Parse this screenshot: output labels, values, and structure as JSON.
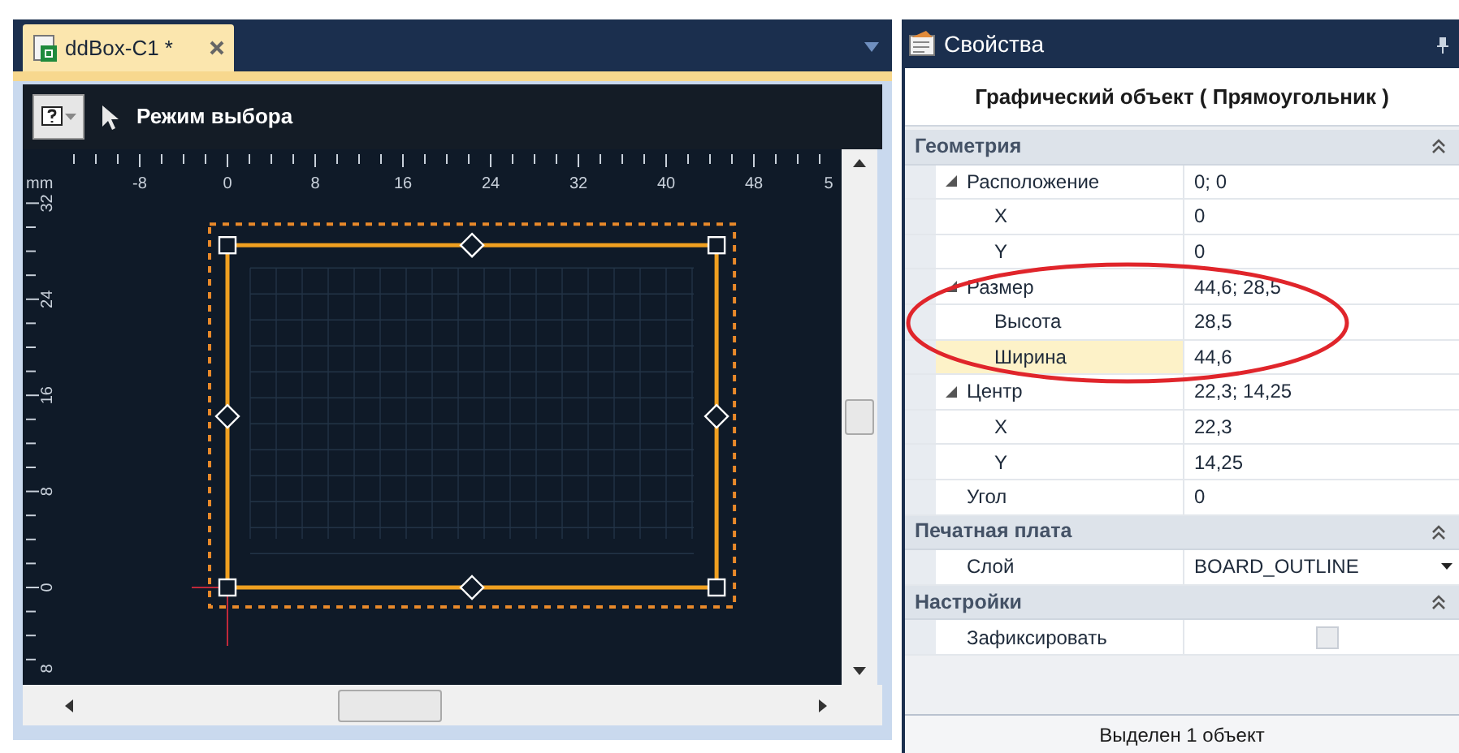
{
  "document_tab": {
    "title": "ddBox-C1 *",
    "selected": true
  },
  "toolbar": {
    "mode_label": "Режим выбора"
  },
  "ruler": {
    "unit": "mm",
    "x_labels": [
      "-8",
      "0",
      "8",
      "16",
      "24",
      "32",
      "40",
      "48",
      "5"
    ],
    "y_labels": [
      "32",
      "24",
      "16",
      "8",
      "0",
      "8"
    ]
  },
  "shape": {
    "kind": "rectangle",
    "selected": true
  },
  "properties_panel": {
    "title": "Свойства",
    "object_title": "Графический объект ( Прямоугольник )",
    "sections": [
      {
        "title": "Геометрия",
        "expanded": true,
        "rows": [
          {
            "label": "Расположение",
            "value": "0; 0",
            "kind": "text",
            "selected": false,
            "expanded": true,
            "children": [
              {
                "label": "X",
                "value": "0",
                "kind": "text",
                "selected": false
              },
              {
                "label": "Y",
                "value": "0",
                "kind": "text",
                "selected": false
              }
            ]
          },
          {
            "label": "Размер",
            "value": "44,6; 28,5",
            "kind": "text",
            "selected": false,
            "expanded": true,
            "children": [
              {
                "label": "Высота",
                "value": "28,5",
                "kind": "text",
                "selected": false
              },
              {
                "label": "Ширина",
                "value": "44,6",
                "kind": "text",
                "selected": true
              }
            ]
          },
          {
            "label": "Центр",
            "value": "22,3; 14,25",
            "kind": "text",
            "selected": false,
            "expanded": true,
            "children": [
              {
                "label": "X",
                "value": "22,3",
                "kind": "text",
                "selected": false
              },
              {
                "label": "Y",
                "value": "14,25",
                "kind": "text",
                "selected": false
              }
            ]
          },
          {
            "label": "Угол",
            "value": "0",
            "kind": "text",
            "selected": false
          }
        ]
      },
      {
        "title": "Печатная плата",
        "expanded": true,
        "rows": [
          {
            "label": "Слой",
            "value": "BOARD_OUTLINE",
            "kind": "dropdown",
            "selected": false
          }
        ]
      },
      {
        "title": "Настройки",
        "expanded": true,
        "rows": [
          {
            "label": "Зафиксировать",
            "kind": "checkbox",
            "checked": false,
            "selected": false
          }
        ]
      }
    ]
  },
  "status_bar": "Выделен 1 объект"
}
